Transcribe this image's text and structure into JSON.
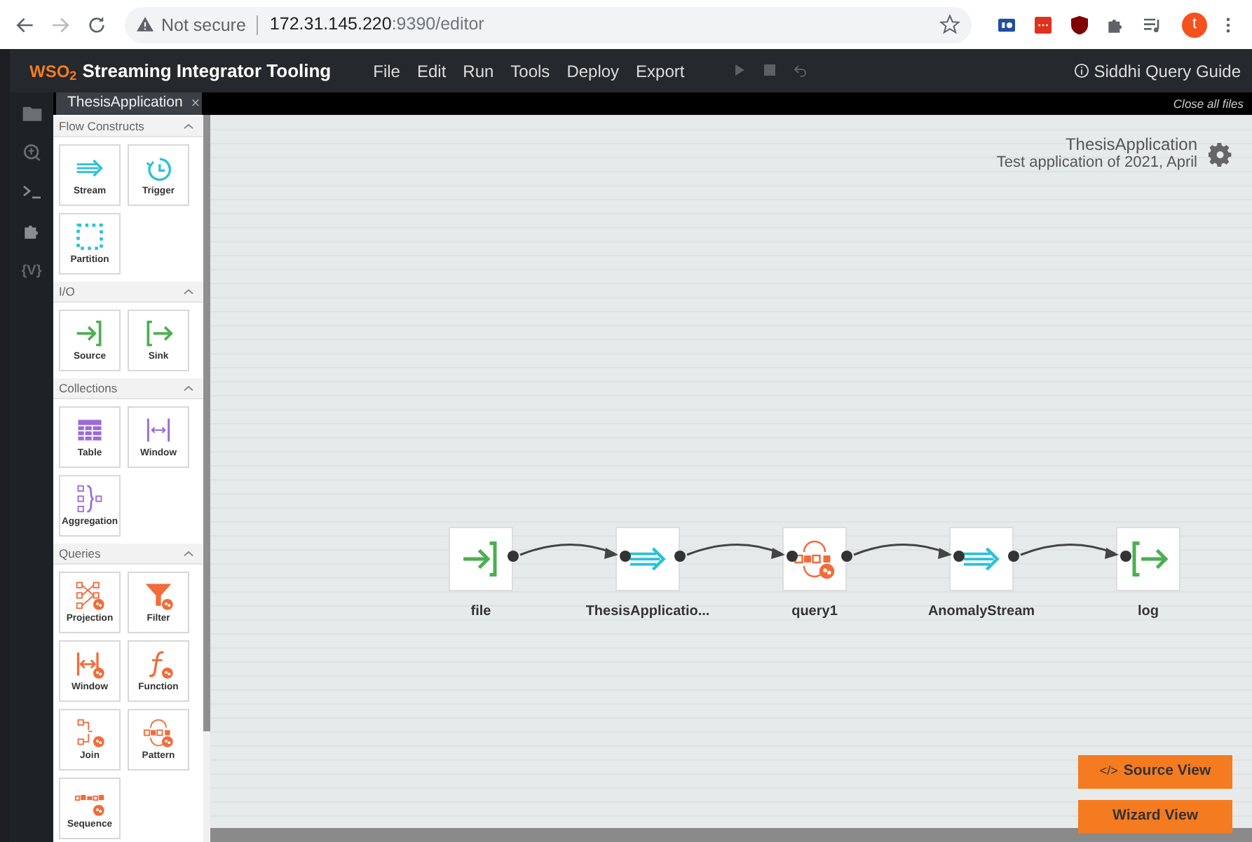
{
  "browser": {
    "nav": [
      {
        "kind": "back",
        "disabled": false
      },
      {
        "kind": "forward",
        "disabled": true
      },
      {
        "kind": "reload",
        "disabled": false
      }
    ],
    "security": "Not secure",
    "url_host": "172.31.145.220",
    "url_rest": ":9390/editor",
    "profile_initial": "t"
  },
  "app": {
    "logo": "WSO$_{2}$",
    "title": "Streaming Integrator Tooling",
    "menu": [
      "File",
      "Edit",
      "Run",
      "Tools",
      "Deploy",
      "Export"
    ],
    "toolbar": [
      {
        "kind": "run",
        "disabled": true
      },
      {
        "kind": "stop",
        "disabled": true
      },
      {
        "kind": "revert",
        "disabled": true
      }
    ],
    "guide_link": "Siddhi Query Guide"
  },
  "side_rail": [
    {
      "kind": "folder"
    },
    {
      "kind": "debug"
    },
    {
      "kind": "console"
    },
    {
      "kind": "extension"
    },
    {
      "kind": "variables",
      "label": "{V}"
    }
  ],
  "tabs": [
    {
      "label": "ThesisApplication",
      "selected": true,
      "close": "×"
    }
  ],
  "close_all": "Close all files",
  "palette": [
    {
      "title": "Flow Constructs",
      "expanded": true,
      "items": [
        {
          "label": "Stream",
          "kind": "stream"
        },
        {
          "label": "Trigger",
          "kind": "trigger"
        },
        {
          "label": "Partition",
          "kind": "partition"
        }
      ]
    },
    {
      "title": "I/O",
      "expanded": true,
      "items": [
        {
          "label": "Source",
          "kind": "source"
        },
        {
          "label": "Sink",
          "kind": "sink"
        }
      ]
    },
    {
      "title": "Collections",
      "expanded": true,
      "items": [
        {
          "label": "Table",
          "kind": "table"
        },
        {
          "label": "Window",
          "kind": "window"
        },
        {
          "label": "Aggregation",
          "kind": "aggregation"
        }
      ]
    },
    {
      "title": "Queries",
      "expanded": true,
      "items": [
        {
          "label": "Projection",
          "kind": "projection"
        },
        {
          "label": "Filter",
          "kind": "filter"
        },
        {
          "label": "Window",
          "kind": "query-window"
        },
        {
          "label": "Function",
          "kind": "function"
        },
        {
          "label": "Join",
          "kind": "join"
        },
        {
          "label": "Pattern",
          "kind": "pattern"
        },
        {
          "label": "Sequence",
          "kind": "sequence"
        }
      ]
    }
  ],
  "canvas": {
    "app_name": "ThesisApplication",
    "description": "Test application of 2021, April",
    "nodes": [
      {
        "label": "file",
        "kind": "source"
      },
      {
        "label": "ThesisApplicatio...",
        "kind": "stream"
      },
      {
        "label": "query1",
        "kind": "pattern"
      },
      {
        "label": "AnomalyStream",
        "kind": "stream"
      },
      {
        "label": "log",
        "kind": "sink"
      }
    ],
    "buttons": [
      {
        "icon_text": "</>",
        "label": "Source View"
      },
      {
        "label": "Wizard View"
      }
    ]
  }
}
